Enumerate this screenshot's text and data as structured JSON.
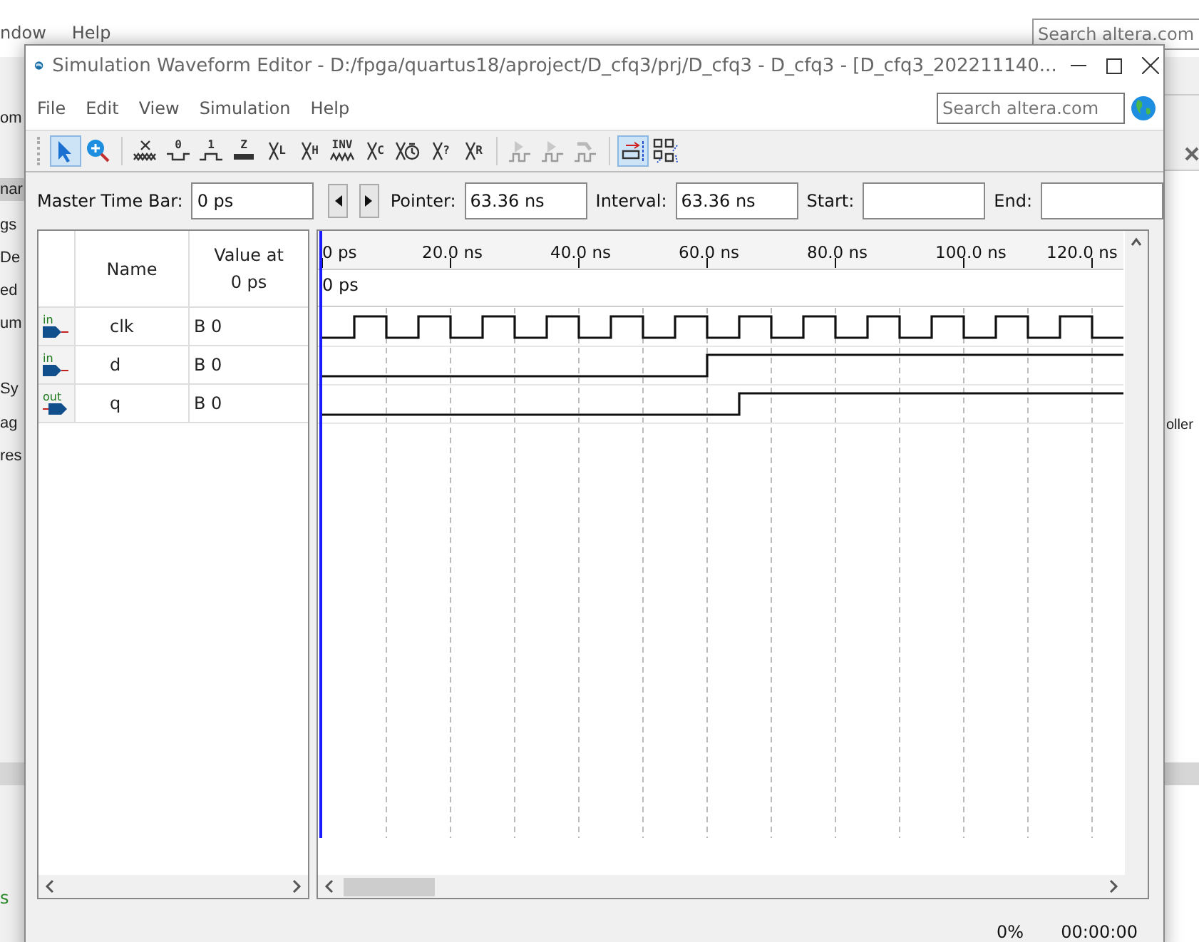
{
  "background_window": {
    "menu": [
      "ndow",
      "Help"
    ],
    "search": {
      "placeholder": "Search altera.com"
    },
    "left_texts": [
      "om",
      "nar",
      "gs",
      "De",
      "ed",
      "um",
      "Sy",
      "ag",
      "res"
    ],
    "right_text": "oller",
    "bottom_left_text": "s"
  },
  "window": {
    "title": "Simulation Waveform Editor - D:/fpga/quartus18/aproject/D_cfq3/prj/D_cfq3 - D_cfq3 - [D_cfq3_202211140..."
  },
  "menu": [
    "File",
    "Edit",
    "View",
    "Simulation",
    "Help"
  ],
  "search": {
    "placeholder": "Search altera.com"
  },
  "toolbar": [
    [
      {
        "kind": "pointer",
        "selected": true,
        "disabled": false
      },
      {
        "kind": "zoom",
        "selected": false,
        "disabled": false
      }
    ],
    [
      {
        "kind": "unknown",
        "selected": false,
        "disabled": false
      },
      {
        "kind": "forcing-low",
        "glyph": "0",
        "selected": false,
        "disabled": false
      },
      {
        "kind": "forcing-high",
        "glyph": "1",
        "selected": false,
        "disabled": false
      },
      {
        "kind": "high-impedance",
        "glyph": "Z",
        "selected": false,
        "disabled": false
      },
      {
        "kind": "weak-low",
        "glyph": "L",
        "selected": false,
        "disabled": false
      },
      {
        "kind": "weak-high",
        "glyph": "H",
        "selected": false,
        "disabled": false
      },
      {
        "kind": "invert",
        "glyph": "INV",
        "selected": false,
        "disabled": false
      },
      {
        "kind": "count",
        "glyph": "C",
        "selected": false,
        "disabled": false
      },
      {
        "kind": "clock",
        "selected": false,
        "disabled": false
      },
      {
        "kind": "dont-care",
        "glyph": "?",
        "selected": false,
        "disabled": false
      },
      {
        "kind": "random",
        "glyph": "R",
        "selected": false,
        "disabled": false
      }
    ],
    [
      {
        "kind": "run-functional",
        "selected": false,
        "disabled": true
      },
      {
        "kind": "run-timing",
        "selected": false,
        "disabled": true
      },
      {
        "kind": "netlist",
        "selected": false,
        "disabled": true
      }
    ],
    [
      {
        "kind": "snap",
        "selected": true,
        "disabled": false
      },
      {
        "kind": "overwrite",
        "selected": false,
        "disabled": false
      }
    ]
  ],
  "time_bar": {
    "master_label": "Master Time Bar:",
    "master_value": "0 ps",
    "pointer_label": "Pointer:",
    "pointer_value": "63.36 ns",
    "interval_label": "Interval:",
    "interval_value": "63.36 ns",
    "start_label": "Start:",
    "end_label": "End:"
  },
  "signals_table": {
    "name_header": "Name",
    "value_header": "Value at",
    "value_time": "0 ps",
    "rows": [
      {
        "direction": "in",
        "name": "clk",
        "value": "B 0"
      },
      {
        "direction": "in",
        "name": "d",
        "value": "B 0"
      },
      {
        "direction": "out",
        "name": "q",
        "value": "B 0"
      }
    ]
  },
  "waveform": {
    "ruler_labels": [
      "0 ps",
      "20.0 ns",
      "40.0 ns",
      "60.0 ns",
      "80.0 ns",
      "100.0 ns",
      "120.0 ns"
    ],
    "cursor_label": "0 ps"
  },
  "status_bar": {
    "progress": "0%",
    "elapsed": "00:00:00"
  }
}
